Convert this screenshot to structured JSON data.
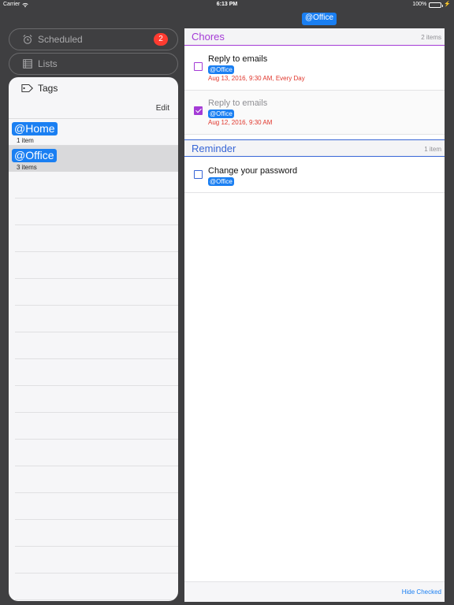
{
  "status_bar": {
    "carrier": "Carrier",
    "time": "6:13 PM",
    "battery": "100%"
  },
  "nav": {
    "title_tag": "@Office"
  },
  "sidebar": {
    "scheduled": {
      "label": "Scheduled",
      "badge": "2"
    },
    "lists": {
      "label": "Lists"
    },
    "tags": {
      "title": "Tags",
      "edit_label": "Edit",
      "items": [
        {
          "name": "@Home",
          "count": "1 item",
          "selected": false
        },
        {
          "name": "@Office",
          "count": "3 items",
          "selected": true
        }
      ]
    }
  },
  "content": {
    "sections": [
      {
        "title": "Chores",
        "count": "2 items",
        "color": "#a43bd6",
        "tasks": [
          {
            "title": "Reply to emails",
            "tag": "@Office",
            "date": "Aug 13, 2016, 9:30 AM, Every Day",
            "checked": false
          },
          {
            "title": "Reply to emails",
            "tag": "@Office",
            "date": "Aug 12, 2016, 9:30 AM",
            "checked": true
          }
        ]
      },
      {
        "title": "Reminder",
        "count": "1 item",
        "color": "#3866d6",
        "tasks": [
          {
            "title": "Change your password",
            "tag": "@Office",
            "checked": false
          }
        ]
      }
    ],
    "footer": {
      "hide_checked": "Hide Checked"
    }
  },
  "colors": {
    "tag_chip": "#1a7ff2",
    "badge": "#ff3b30",
    "date_red": "#e0362c"
  }
}
